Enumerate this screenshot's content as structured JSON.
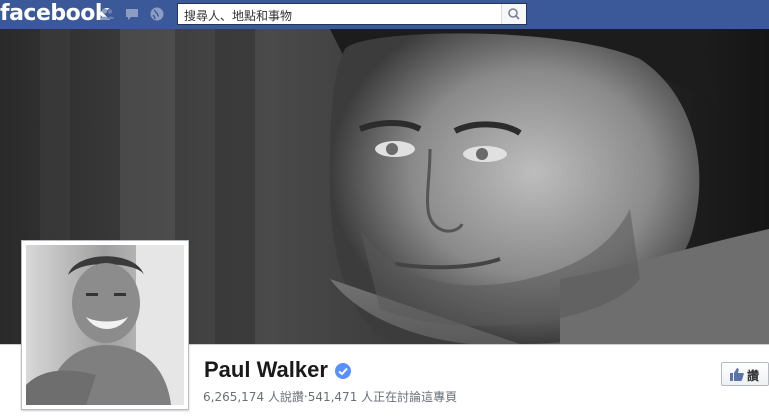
{
  "header": {
    "logo": "facebook",
    "search_placeholder": "搜尋人、地點和事物",
    "icons": [
      "friends-icon",
      "messages-icon",
      "notifications-globe-icon",
      "search-icon"
    ],
    "brand_color": "#3b5998"
  },
  "page": {
    "name": "Paul Walker",
    "verified": true,
    "stats": "6,265,174 人說讚‧541,471 人正在討論這專頁"
  },
  "actions": {
    "like_label": "讚"
  }
}
